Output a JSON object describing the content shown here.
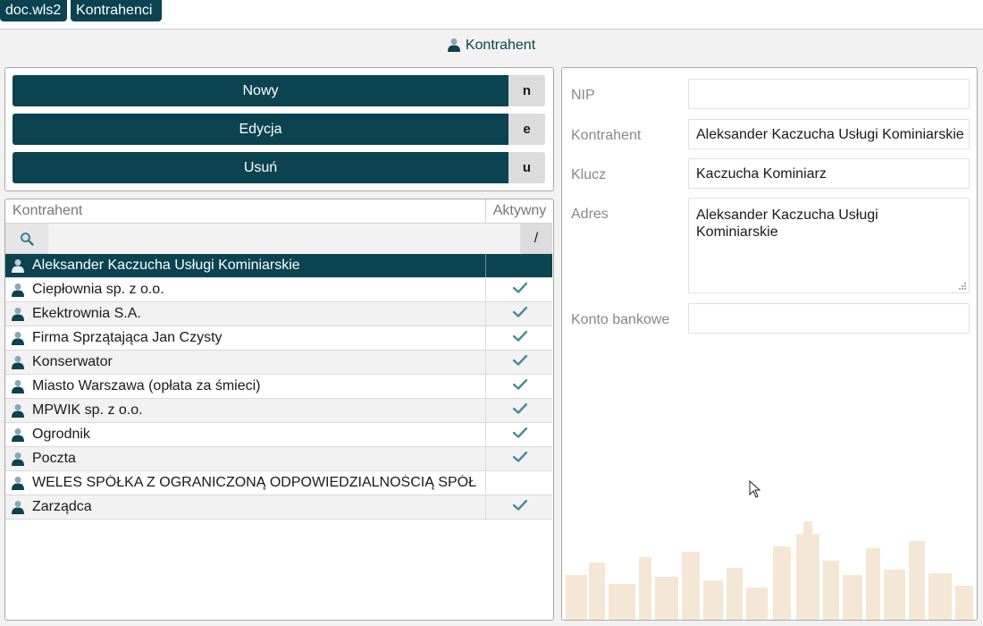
{
  "breadcrumbs": [
    "doc.wls2",
    "Kontrahenci"
  ],
  "subtitle": "Kontrahent",
  "actions": [
    {
      "label": "Nowy",
      "key": "n"
    },
    {
      "label": "Edycja",
      "key": "e"
    },
    {
      "label": "Usuń",
      "key": "u"
    }
  ],
  "table": {
    "col_name": "Kontrahent",
    "col_active": "Aktywny",
    "filter_slash": "/",
    "rows": [
      {
        "name": "Aleksander Kaczucha Usługi Kominiarskie",
        "active": false,
        "selected": true
      },
      {
        "name": "Ciepłownia sp. z o.o.",
        "active": true
      },
      {
        "name": "Ekektrownia S.A.",
        "active": true
      },
      {
        "name": "Firma Sprzątająca Jan Czysty",
        "active": true
      },
      {
        "name": "Konserwator",
        "active": true
      },
      {
        "name": "Miasto Warszawa (opłata za śmieci)",
        "active": true
      },
      {
        "name": "MPWIK sp. z o.o.",
        "active": true
      },
      {
        "name": "Ogrodnik",
        "active": true
      },
      {
        "name": "Poczta",
        "active": true
      },
      {
        "name": "WELES SPÓŁKA Z OGRANICZONĄ ODPOWIEDZIALNOŚCIĄ SPÓŁ",
        "active": false
      },
      {
        "name": "Zarządca",
        "active": true
      }
    ]
  },
  "form": {
    "nip": {
      "label": "NIP",
      "value": ""
    },
    "kontrahent": {
      "label": "Kontrahent",
      "value": "Aleksander Kaczucha Usługi Kominiarskie"
    },
    "klucz": {
      "label": "Klucz",
      "value": "Kaczucha Kominiarz"
    },
    "adres": {
      "label": "Adres",
      "value": "Aleksander Kaczucha Usługi Kominiarskie"
    },
    "konto": {
      "label": "Konto bankowe",
      "value": ""
    }
  },
  "icons": {
    "person": "person-icon",
    "search": "search-icon",
    "check": "check-icon"
  },
  "colors": {
    "primary": "#0b4350",
    "check": "#4a8a9a"
  }
}
